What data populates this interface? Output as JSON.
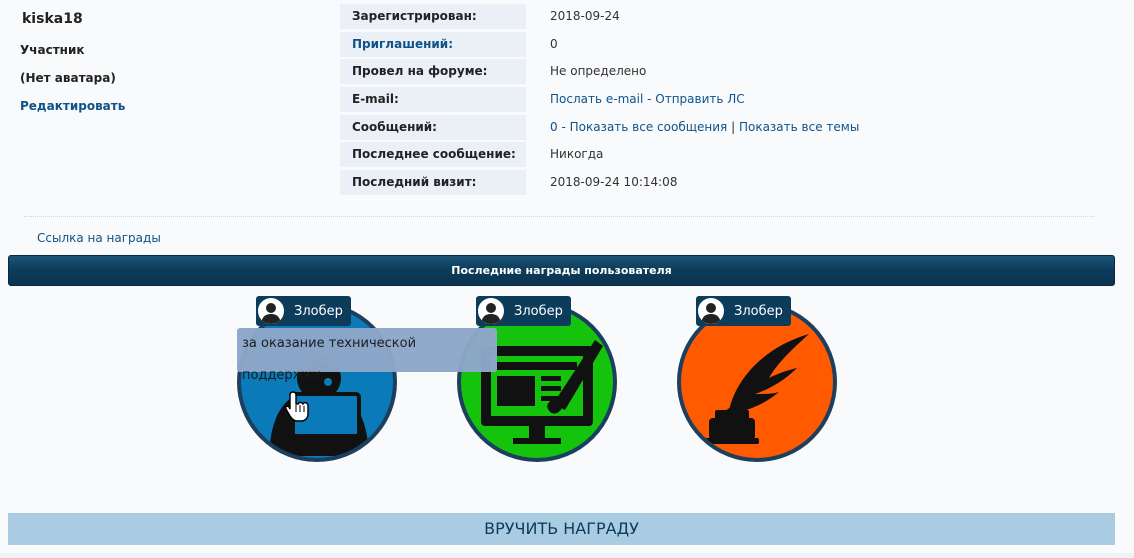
{
  "user": {
    "username": "kiska18",
    "rank": "Участник",
    "avatar_text": "(Нет аватара)",
    "edit_label": "Редактировать"
  },
  "profile": {
    "rows": [
      {
        "label": "Зарегистрирован:",
        "value": "2018-09-24"
      },
      {
        "label": "Приглашений:",
        "value": "0"
      },
      {
        "label": "Провел на форуме:",
        "value": "Не определено"
      },
      {
        "label": "E-mail:",
        "link1": "Послать e-mail",
        "sep": " - ",
        "link2": "Отправить ЛС"
      },
      {
        "label": "Сообщений:",
        "prefix": "0 - ",
        "link1": "Показать все сообщения",
        "sep": " | ",
        "link2": "Показать все темы"
      },
      {
        "label": "Последнее сообщение:",
        "value": "Никогда"
      },
      {
        "label": "Последний визит:",
        "value": "2018-09-24 10:14:08"
      }
    ]
  },
  "awards": {
    "link_label": "Ссылка на награды",
    "header": "Последние награды пользователя",
    "items": [
      {
        "giver": "Злобер",
        "color": "#0a7ab8",
        "icon": "support-operator-icon"
      },
      {
        "giver": "Злобер",
        "color": "#14c40c",
        "icon": "web-design-icon"
      },
      {
        "giver": "Злобер",
        "color": "#ff5a00",
        "icon": "quill-inkwell-icon"
      }
    ],
    "tooltip": "за оказание технической поддержки"
  },
  "give_button_label": "ВРУЧИТЬ НАГРАДУ"
}
